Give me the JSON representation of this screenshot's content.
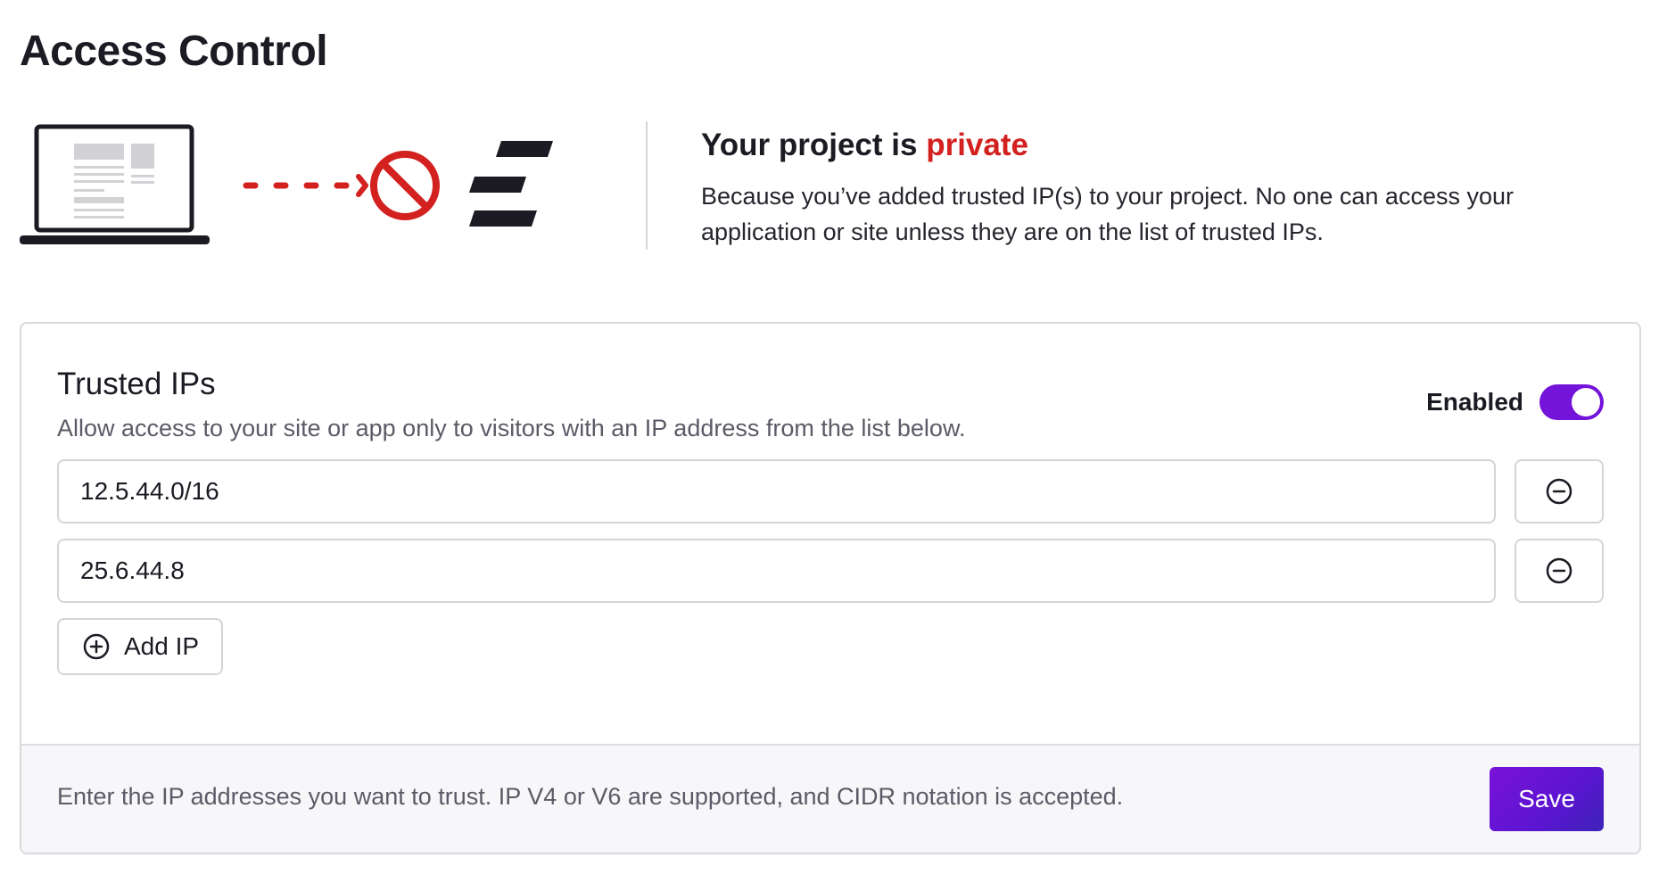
{
  "page": {
    "title": "Access Control"
  },
  "hero": {
    "heading_prefix": "Your project is",
    "heading_status": "private",
    "description": "Because you’ve added trusted IP(s) to your project. No one can access your application or site unless they are on the list of trusted IPs.",
    "icons": [
      "laptop-icon",
      "dashed-arrow-icon",
      "blocked-icon",
      "platform-logo-icon"
    ],
    "colors": {
      "status_accent": "#d3211f",
      "arrow": "#d3211f"
    }
  },
  "trusted_ips": {
    "title": "Trusted IPs",
    "subtitle": "Allow access to your site or app only to visitors with an IP address from the list below.",
    "toggle_label": "Enabled",
    "toggle_enabled": true,
    "entries": [
      {
        "value": "12.5.44.0/16"
      },
      {
        "value": "25.6.44.8"
      }
    ],
    "add_label": "Add IP",
    "footer_hint": "Enter the IP addresses you want to trust. IP V4 or V6 are supported, and CIDR notation is accepted.",
    "save_label": "Save",
    "colors": {
      "primary": "#7413d9",
      "save_gradient_end": "#3c23b8"
    }
  }
}
